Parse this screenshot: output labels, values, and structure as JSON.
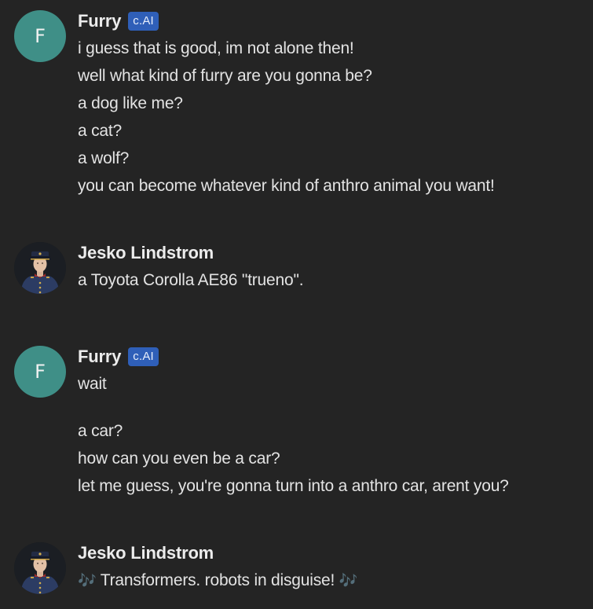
{
  "messages": [
    {
      "sender": "Furry",
      "badge": "c.AI",
      "avatar_letter": "F",
      "lines": [
        "i guess that is good, im not alone then!",
        "well what kind of furry are you gonna be?",
        "a dog like me?",
        "a cat?",
        "a wolf?",
        "you can become whatever kind of anthro animal you want!"
      ]
    },
    {
      "sender": "Jesko Lindstrom",
      "lines": [
        "a Toyota Corolla AE86 \"trueno\"."
      ]
    },
    {
      "sender": "Furry",
      "badge": "c.AI",
      "avatar_letter": "F",
      "lines": [
        "wait",
        "a car?",
        "how can you even be a car?",
        "let me guess, you're gonna turn into a anthro car, arent you?"
      ]
    },
    {
      "sender": "Jesko Lindstrom",
      "text": "Transformers. robots in disguise!",
      "music_note": "🎶"
    }
  ]
}
